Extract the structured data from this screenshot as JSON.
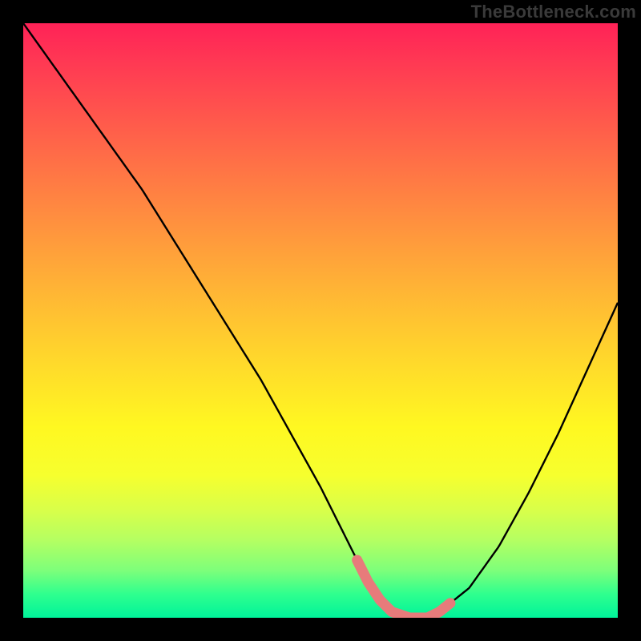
{
  "watermark": "TheBottleneck.com",
  "chart_data": {
    "type": "line",
    "title": "",
    "xlabel": "",
    "ylabel": "",
    "xlim": [
      0,
      100
    ],
    "ylim": [
      0,
      100
    ],
    "x": [
      0,
      5,
      10,
      15,
      20,
      25,
      30,
      35,
      40,
      45,
      50,
      55,
      58,
      60,
      62,
      65,
      68,
      70,
      75,
      80,
      85,
      90,
      95,
      100
    ],
    "values": [
      100,
      93,
      86,
      79,
      72,
      64,
      56,
      48,
      40,
      31,
      22,
      12,
      6,
      3,
      1,
      0,
      0,
      1,
      5,
      12,
      21,
      31,
      42,
      53
    ],
    "highlight_range_x": [
      56,
      72
    ],
    "highlight_stroke": "#e77b7b",
    "curve_stroke": "#000000"
  }
}
